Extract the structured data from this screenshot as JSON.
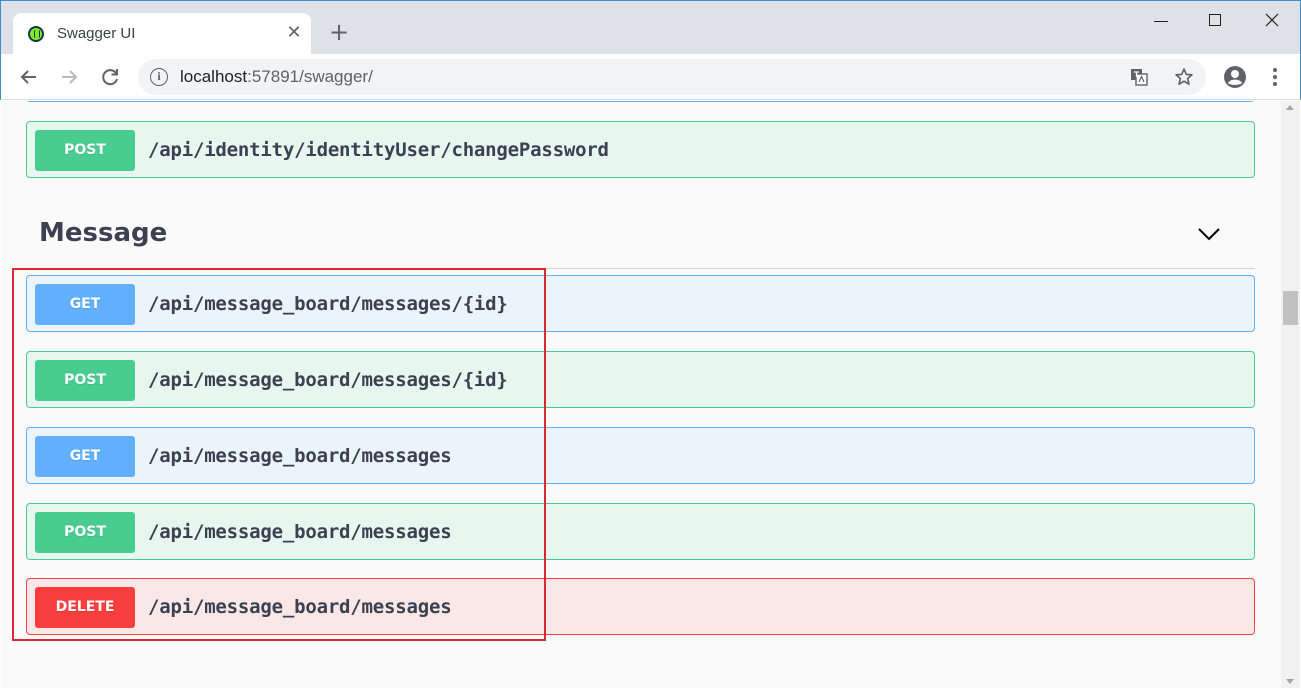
{
  "browser": {
    "tab": {
      "title": "Swagger UI",
      "close_glyph": "✕"
    },
    "new_tab_glyph": "+",
    "address": {
      "host": "localhost",
      "port_and_path": ":57891/swagger/"
    },
    "icons": [
      "favicon-icon",
      "close-icon",
      "new-tab-icon",
      "minimize-icon",
      "maximize-icon",
      "window-close-icon",
      "back-icon",
      "forward-icon",
      "reload-icon",
      "site-info-icon",
      "translate-icon",
      "bookmark-star-icon",
      "profile-icon",
      "menu-icon"
    ]
  },
  "swagger": {
    "top_operation": {
      "method": "POST",
      "path": "/api/identity/identityUser/changePassword"
    },
    "tag": {
      "name": "Message",
      "expanded": true
    },
    "operations": [
      {
        "method": "GET",
        "path": "/api/message_board/messages/{id}"
      },
      {
        "method": "POST",
        "path": "/api/message_board/messages/{id}"
      },
      {
        "method": "GET",
        "path": "/api/message_board/messages"
      },
      {
        "method": "POST",
        "path": "/api/message_board/messages"
      },
      {
        "method": "DELETE",
        "path": "/api/message_board/messages"
      }
    ],
    "colors": {
      "get": "#61affe",
      "post": "#49cc90",
      "delete": "#f93e3e",
      "highlight": "#d9292f"
    }
  }
}
